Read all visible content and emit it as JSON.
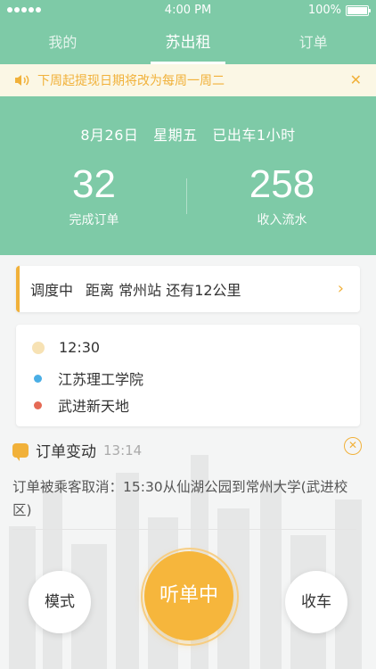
{
  "status_bar": {
    "time": "4:00 PM",
    "battery": "100%"
  },
  "tabs": [
    {
      "label": "我的"
    },
    {
      "label": "苏出租"
    },
    {
      "label": "订单"
    }
  ],
  "notice": {
    "text": "下周起提现日期将改为每周一周二"
  },
  "summary": {
    "date_line": "8月26日   星期五   已出车1小时",
    "orders_count": "32",
    "orders_label": "完成订单",
    "income": "258",
    "income_label": "收入流水"
  },
  "dispatch": {
    "status": "调度中",
    "text": "距离 常州站 还有12公里"
  },
  "trip": {
    "time": "12:30",
    "pickup": "江苏理工学院",
    "dropoff": "武进新天地"
  },
  "order_change": {
    "title": "订单变动",
    "time": "13:14",
    "message": "订单被乘客取消：15:30从仙湖公园到常州大学(武进校区)"
  },
  "bottom": {
    "mode_label": "模式",
    "main_label": "听单中",
    "close_label": "收车"
  },
  "colors": {
    "primary": "#7ecaa7",
    "accent": "#f1b13a",
    "pickup_dot": "#4aaee5",
    "dropoff_dot": "#e56a55"
  }
}
